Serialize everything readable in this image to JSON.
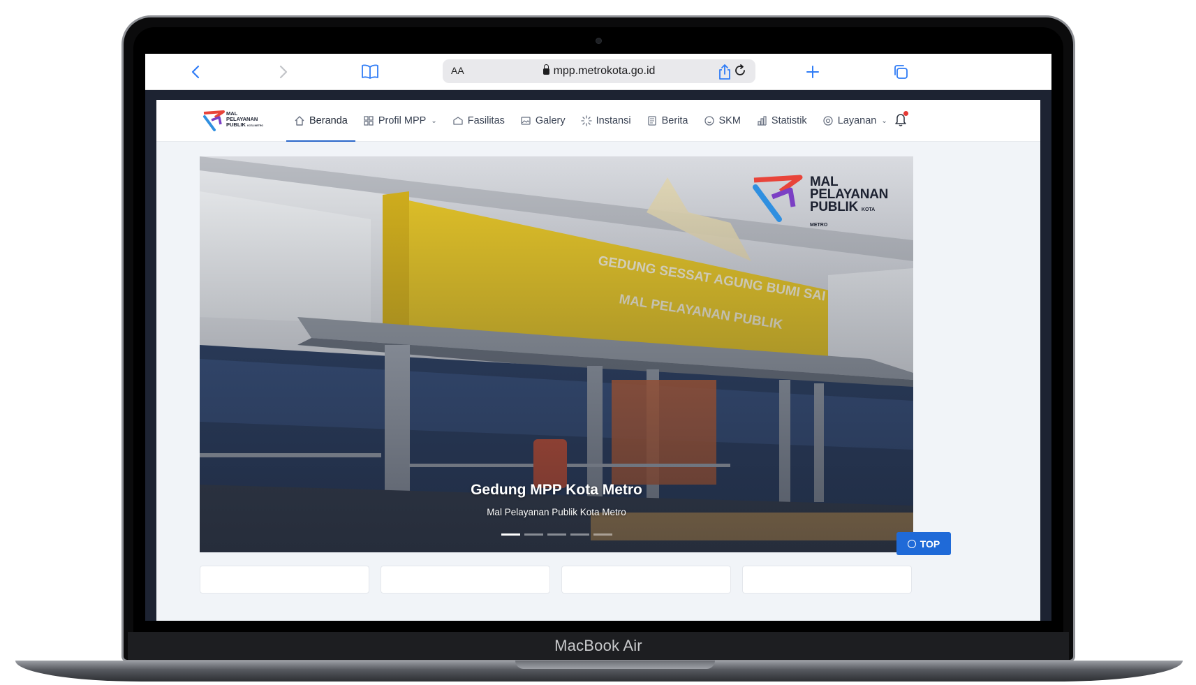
{
  "device": {
    "brand_label": "MacBook Air"
  },
  "browser": {
    "address": "mpp.metrokota.go.id",
    "reader_label": "AA",
    "icons": [
      "back-icon",
      "forward-icon",
      "bookmarks-icon",
      "lock-icon",
      "reload-icon",
      "share-icon",
      "new-tab-icon",
      "tabs-icon"
    ]
  },
  "site": {
    "logo_lines": [
      "MAL",
      "PELAYANAN",
      "PUBLIK"
    ],
    "logo_small": "KOTA METRO",
    "nav": [
      {
        "label": "Beranda",
        "icon": "home-icon"
      },
      {
        "label": "Profil MPP",
        "icon": "grid-icon"
      },
      {
        "label": "Fasilitas",
        "icon": "building-icon"
      },
      {
        "label": "Galery",
        "icon": "image-icon"
      },
      {
        "label": "Instansi",
        "icon": "spinner-icon"
      },
      {
        "label": "Berita",
        "icon": "news-icon"
      },
      {
        "label": "SKM",
        "icon": "smile-icon"
      },
      {
        "label": "Statistik",
        "icon": "chart-icon"
      },
      {
        "label": "Layanan",
        "icon": "lifebuoy-icon"
      }
    ],
    "active_nav": "Beranda",
    "hero": {
      "title": "Gedung MPP Kota Metro",
      "subtitle": "Mal Pelayanan Publik Kota Metro",
      "slides": 5,
      "active_slide": 1
    },
    "top_button": "TOP",
    "colors": {
      "accent": "#1f6ad8",
      "logo_red": "#e8443a",
      "logo_blue": "#2f8fe0",
      "logo_purple": "#7b3fc4",
      "notification": "#e53935"
    }
  }
}
